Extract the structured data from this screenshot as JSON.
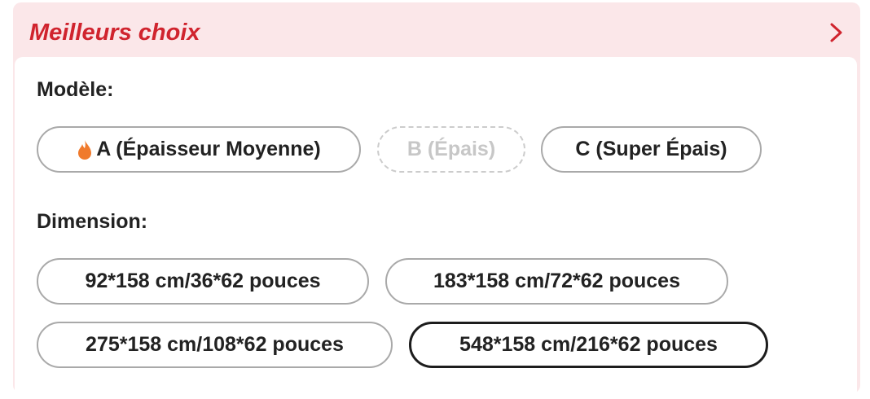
{
  "header": {
    "title": "Meilleurs choix"
  },
  "model": {
    "label": "Modèle:",
    "options": [
      {
        "label": "A (Épaisseur Moyenne)",
        "icon": "fire-icon",
        "state": "normal"
      },
      {
        "label": "B (Épais)",
        "state": "disabled"
      },
      {
        "label": "C (Super Épais)",
        "state": "normal"
      }
    ]
  },
  "dimension": {
    "label": "Dimension:",
    "options": [
      {
        "label": "92*158 cm/36*62 pouces",
        "state": "normal"
      },
      {
        "label": "183*158 cm/72*62 pouces",
        "state": "normal"
      },
      {
        "label": "275*158 cm/108*62 pouces",
        "state": "normal"
      },
      {
        "label": "548*158 cm/216*62 pouces",
        "state": "selected"
      }
    ]
  },
  "colors": {
    "accent": "#d0242e",
    "header_bg": "#fbe7e9",
    "icon_fire": "#f07a2c"
  }
}
